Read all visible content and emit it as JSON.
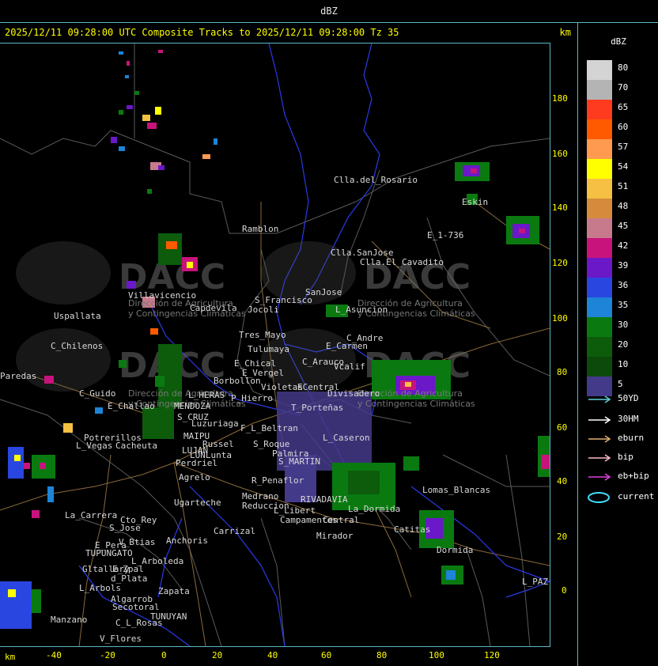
{
  "window": {
    "title": "dBZ"
  },
  "header": {
    "text": "2025/12/11 09:28:00 UTC Composite Tracks to 2025/12/11 09:28:00 Tz 35",
    "km_label": "km"
  },
  "axes": {
    "x_label": "km",
    "x_ticks": [
      "-40",
      "-20",
      "0",
      "20",
      "40",
      "60",
      "80",
      "100",
      "120"
    ],
    "y_ticks": [
      "180",
      "160",
      "140",
      "120",
      "100",
      "80",
      "60",
      "40",
      "20",
      "0"
    ]
  },
  "legend": {
    "title": "dBZ",
    "scale": [
      {
        "value": "80",
        "color": "#d4d4d4"
      },
      {
        "value": "70",
        "color": "#b4b4b4"
      },
      {
        "value": "65",
        "color": "#ff3b1f"
      },
      {
        "value": "60",
        "color": "#ff5a00"
      },
      {
        "value": "57",
        "color": "#ff9a50"
      },
      {
        "value": "54",
        "color": "#ffff00"
      },
      {
        "value": "51",
        "color": "#f5c043"
      },
      {
        "value": "48",
        "color": "#d68b3c"
      },
      {
        "value": "45",
        "color": "#c77a8c"
      },
      {
        "value": "42",
        "color": "#c8137c"
      },
      {
        "value": "39",
        "color": "#6a18c8"
      },
      {
        "value": "36",
        "color": "#2a46e0"
      },
      {
        "value": "35",
        "color": "#1d84d8"
      },
      {
        "value": "30",
        "color": "#0a7a10"
      },
      {
        "value": "20",
        "color": "#0c5c0c"
      },
      {
        "value": "10",
        "color": "#0b4a0b"
      },
      {
        "value": "5",
        "color": "#443a8a"
      }
    ],
    "tracks": [
      {
        "label": "50YD",
        "color": "#5fd0d8"
      },
      {
        "label": "30HM",
        "color": "#ffffff"
      },
      {
        "label": "eburn",
        "color": "#e0b070"
      },
      {
        "label": "bip",
        "color": "#ffb8c8"
      },
      {
        "label": "eb+bip",
        "color": "#e040e0"
      },
      {
        "label": "current",
        "color": "#40e0ff"
      }
    ]
  },
  "watermark": {
    "name": "DACC",
    "line1": "Dirección de Agricultura",
    "line2": "y Contingencias Climáticas"
  },
  "places": [
    {
      "name": "Clla.del_Rosario"
    },
    {
      "name": "Ramblon"
    },
    {
      "name": "E_1-736"
    },
    {
      "name": "Clla.SanJose"
    },
    {
      "name": "Clla.El_Cavadito"
    },
    {
      "name": "Villavicencio"
    },
    {
      "name": "Capdevila"
    },
    {
      "name": "S_Francisco"
    },
    {
      "name": "Jocoli"
    },
    {
      "name": "SanJose"
    },
    {
      "name": "L_Asuncion"
    },
    {
      "name": "Uspallata"
    },
    {
      "name": "Tres_Mayo"
    },
    {
      "name": "Tulumaya"
    },
    {
      "name": "C_Andre"
    },
    {
      "name": "E_Carmen"
    },
    {
      "name": "C_Chilenos"
    },
    {
      "name": "E_Chical"
    },
    {
      "name": "C_Arauco"
    },
    {
      "name": "Vcalif"
    },
    {
      "name": "E_Vergel"
    },
    {
      "name": "Borbollon"
    },
    {
      "name": "Violetas"
    },
    {
      "name": "ECentral"
    },
    {
      "name": "Divisadero"
    },
    {
      "name": "L_HERAS"
    },
    {
      "name": "P_Hierro"
    },
    {
      "name": "C_Guido"
    },
    {
      "name": "E_Challao"
    },
    {
      "name": "MENDOZA"
    },
    {
      "name": "T_Porteñas"
    },
    {
      "name": "S_CRUZ"
    },
    {
      "name": "Luzuriaga"
    },
    {
      "name": "F_L_Beltran"
    },
    {
      "name": "MAIPU"
    },
    {
      "name": "Russel"
    },
    {
      "name": "S_Roque"
    },
    {
      "name": "L_Caseron"
    },
    {
      "name": "Potrerillos"
    },
    {
      "name": "Cacheuta"
    },
    {
      "name": "L_Vegas"
    },
    {
      "name": "LUJAN"
    },
    {
      "name": "LUNLunta"
    },
    {
      "name": "Perdriel"
    },
    {
      "name": "Palmira"
    },
    {
      "name": "S_MARTIN"
    },
    {
      "name": "Agrelo"
    },
    {
      "name": "R_Penaflor"
    },
    {
      "name": "Lomas_Blancas"
    },
    {
      "name": "Ugarteche"
    },
    {
      "name": "Medrano"
    },
    {
      "name": "Reduccion"
    },
    {
      "name": "RIVADAVIA"
    },
    {
      "name": "La_Dormida"
    },
    {
      "name": "La_Carrera"
    },
    {
      "name": "Cto_Rey"
    },
    {
      "name": "S_Jose"
    },
    {
      "name": "L_Libert"
    },
    {
      "name": "Campamentos"
    },
    {
      "name": "Central"
    },
    {
      "name": "Catitas"
    },
    {
      "name": "Carrizal"
    },
    {
      "name": "V_Btias"
    },
    {
      "name": "Anchoris"
    },
    {
      "name": "E_Pera"
    },
    {
      "name": "TUPUNGATO"
    },
    {
      "name": "Mirador"
    },
    {
      "name": "Dormida"
    },
    {
      "name": "L_Arboleda"
    },
    {
      "name": "E_Zpal"
    },
    {
      "name": "Gltallary"
    },
    {
      "name": "d_Plata"
    },
    {
      "name": "L_Arbols"
    },
    {
      "name": "Zapata"
    },
    {
      "name": "Algarrob"
    },
    {
      "name": "Secotoral"
    },
    {
      "name": "TUNUYAN"
    },
    {
      "name": "Manzano"
    },
    {
      "name": "C_L_Rosas"
    },
    {
      "name": "V_Flores"
    },
    {
      "name": "L_PAZ"
    },
    {
      "name": "Paredas"
    },
    {
      "name": "Eskin"
    }
  ]
}
